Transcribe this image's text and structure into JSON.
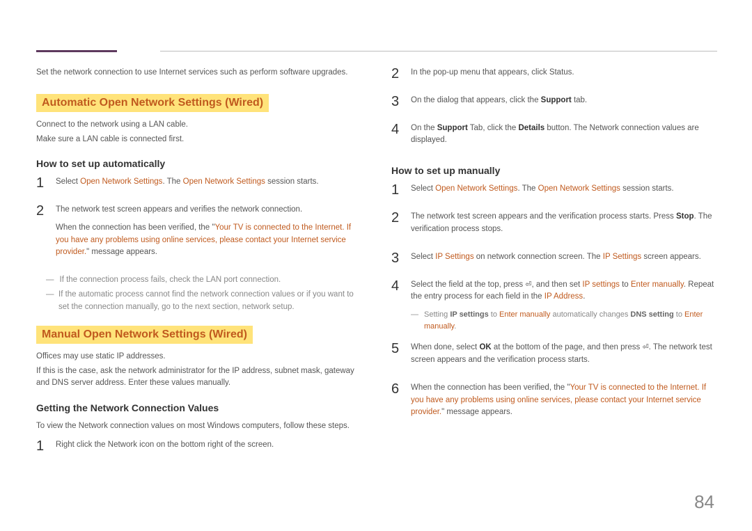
{
  "page_number": "84",
  "left": {
    "intro": "Set the network connection to use Internet services such as perform software upgrades.",
    "sec1_heading": "Automatic Open Network Settings (Wired)",
    "sec1_p1": "Connect to the network using a LAN cable.",
    "sec1_p2": "Make sure a LAN cable is connected first.",
    "sec1_sub": "How to set up automatically",
    "s1": {
      "num": "1",
      "a": "Select ",
      "b": "Open Network Settings",
      "c": ". The ",
      "d": "Open Network Settings",
      "e": " session starts."
    },
    "s2": {
      "num": "2",
      "p1": "The network test screen appears and verifies the network connection.",
      "p2a": "When the connection has been verified, the \"",
      "p2b": "Your TV is connected to the Internet. If you have any problems using online services, please contact your Internet service provider.",
      "p2c": "\" message appears."
    },
    "note1": "If the connection process fails, check the LAN port connection.",
    "note2": "If the automatic process cannot find the network connection values or if you want to set the connection manually, go to the next section, network setup.",
    "sec2_heading": "Manual Open Network Settings (Wired)",
    "sec2_p1": "Offices may use static IP addresses.",
    "sec2_p2": "If this is the case, ask the network administrator for the IP address, subnet mask, gateway and DNS server address. Enter these values manually.",
    "sec2_sub": "Getting the Network Connection Values",
    "sec2_p3": "To view the Network connection values on most Windows computers, follow these steps.",
    "g1": {
      "num": "1",
      "t": "Right click the Network icon on the bottom right of the screen."
    }
  },
  "right": {
    "g2": {
      "num": "2",
      "t": "In the pop-up menu that appears, click Status."
    },
    "g3": {
      "num": "3",
      "a": "On the dialog that appears, click the ",
      "b": "Support",
      "c": " tab."
    },
    "g4": {
      "num": "4",
      "a": "On the ",
      "b": "Support",
      "c": " Tab, click the ",
      "d": "Details",
      "e": " button. The Network connection values are displayed."
    },
    "sub": "How to set up manually",
    "m1": {
      "num": "1",
      "a": "Select ",
      "b": "Open Network Settings",
      "c": ". The ",
      "d": "Open Network Settings",
      "e": " session starts."
    },
    "m2": {
      "num": "2",
      "a": "The network test screen appears and the verification process starts. Press ",
      "b": "Stop",
      "c": ". The verification process stops."
    },
    "m3": {
      "num": "3",
      "a": "Select ",
      "b": "IP Settings",
      "c": " on network connection screen. The ",
      "d": "IP Settings",
      "e": " screen appears."
    },
    "m4": {
      "num": "4",
      "a": "Select the field at the top, press ",
      "b": ", and then set ",
      "c": "IP settings",
      "d": " to ",
      "e": "Enter manually",
      "f": ". Repeat the entry process for each field in the ",
      "g": "IP Address",
      "h": ".",
      "note_a": "Setting ",
      "note_b": "IP settings",
      "note_c": " to ",
      "note_d": "Enter manually",
      "note_e": " automatically changes ",
      "note_f": "DNS setting",
      "note_g": " to ",
      "note_h": "Enter manually",
      "note_i": "."
    },
    "m5": {
      "num": "5",
      "a": "When done, select ",
      "b": "OK",
      "c": " at the bottom of the page, and then press ",
      "d": ". The network test screen appears and the verification process starts."
    },
    "m6": {
      "num": "6",
      "a": "When the connection has been verified, the \"",
      "b": "Your TV is connected to the Internet. If you have any problems using online services, please contact your Internet service provider.",
      "c": "\" message appears."
    }
  },
  "icons": {
    "enter": "⏎"
  },
  "dash": "―"
}
